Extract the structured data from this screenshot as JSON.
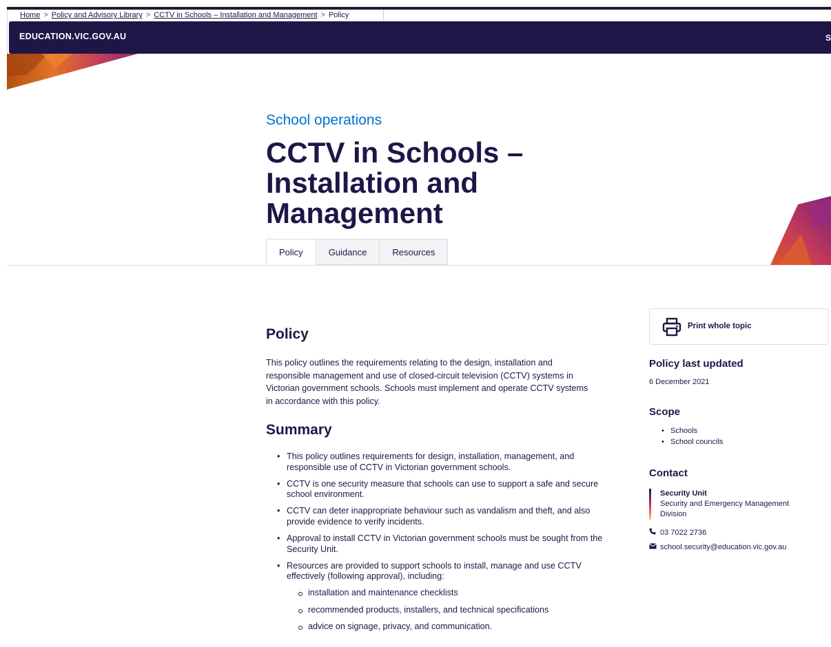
{
  "breadcrumb": {
    "items": [
      "Home",
      "Policy and Advisory Library",
      "CCTV in Schools – Installation and Management"
    ],
    "current": "Policy",
    "separator": ">"
  },
  "header": {
    "brand": "EDUCATION.VIC.GOV.AU",
    "right_fragment": "S"
  },
  "page": {
    "topic": "School operations",
    "title": "CCTV in Schools – Installation and Management"
  },
  "tabs": [
    {
      "label": "Policy",
      "active": true
    },
    {
      "label": "Guidance",
      "active": false
    },
    {
      "label": "Resources",
      "active": false
    }
  ],
  "policy": {
    "heading": "Policy",
    "intro": "This policy outlines the requirements relating to the design, installation and responsible management and use of closed-circuit television (CCTV) systems in Victorian government schools. Schools must implement and operate CCTV systems in accordance with this policy."
  },
  "summary": {
    "heading": "Summary",
    "items": [
      "This policy outlines requirements for design, installation, management, and responsible use of CCTV in Victorian government schools.",
      "CCTV is one security measure that schools can use to support a safe and secure school environment.",
      "CCTV can deter inappropriate behaviour such as vandalism and theft, and also provide evidence to verify incidents.",
      "Approval to install CCTV in Victorian government schools must be sought from the Security Unit.",
      "Resources are provided to support schools to install, manage and use CCTV effectively (following approval), including:"
    ],
    "sub_items": [
      "installation and maintenance checklists",
      "recommended products, installers, and technical specifications",
      "advice on signage, privacy, and communication."
    ]
  },
  "sidebar": {
    "print_label": "Print whole topic",
    "print_icon": "printer-icon",
    "last_updated_heading": "Policy last updated",
    "last_updated_date": "6 December 2021",
    "scope_heading": "Scope",
    "scope_items": [
      "Schools",
      "School councils"
    ],
    "contact_heading": "Contact",
    "contact_name": "Security Unit",
    "contact_org": "Security and Emergency Management Division",
    "phone_icon": "phone-icon",
    "phone": "03 7022 2736",
    "email_icon": "mail-icon",
    "email": "school.security@education.vic.gov.au"
  },
  "colors": {
    "navy": "#201547",
    "topic_blue": "#0072ce",
    "tab_bg": "#f3f3f6"
  }
}
